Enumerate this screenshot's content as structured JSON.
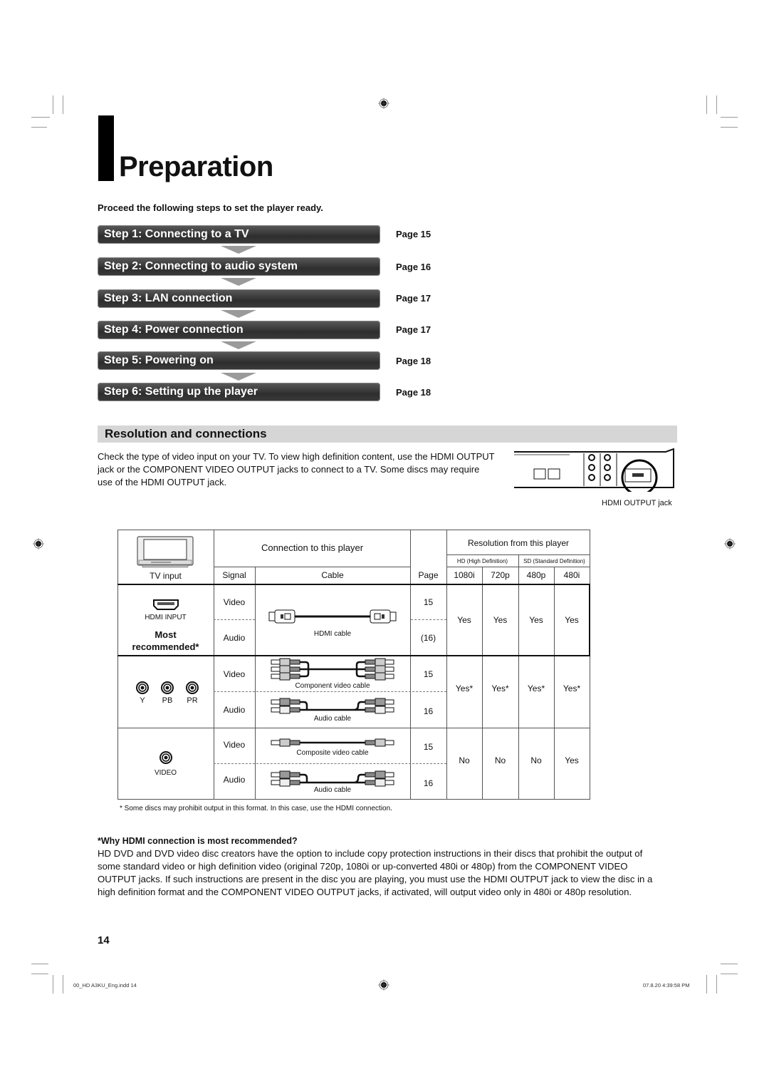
{
  "page": {
    "title": "Preparation",
    "intro": "Proceed the following steps to set the player ready.",
    "page_number": "14"
  },
  "steps": [
    {
      "label": "Step 1: Connecting to a TV",
      "page": "Page 15"
    },
    {
      "label": "Step 2: Connecting to audio system",
      "page": "Page 16"
    },
    {
      "label": "Step 3: LAN connection",
      "page": "Page 17"
    },
    {
      "label": "Step 4: Power connection",
      "page": "Page 17"
    },
    {
      "label": "Step 5: Powering on",
      "page": "Page 18"
    },
    {
      "label": "Step 6: Setting up the player",
      "page": "Page 18"
    }
  ],
  "section": {
    "title": "Resolution and connections",
    "description": "Check the type of video input on your TV. To view high definition content, use the HDMI OUTPUT jack or the COMPONENT VIDEO OUTPUT jacks to connect to a TV. Some discs may require use of the HDMI OUTPUT jack.",
    "diagram_caption": "HDMI OUTPUT jack"
  },
  "table": {
    "header": {
      "tv_input": "TV input",
      "connection": "Connection to this player",
      "resolution": "Resolution from this player",
      "hd": "HD (High Definition)",
      "sd": "SD (Standard Definition)",
      "signal": "Signal",
      "cable": "Cable",
      "page": "Page",
      "res_cols": [
        "1080i",
        "720p",
        "480p",
        "480i"
      ]
    },
    "rows": [
      {
        "input_label": "HDMI INPUT",
        "note": "Most recommended*",
        "signals": [
          "Video",
          "Audio"
        ],
        "cable_labels": [
          "HDMI cable"
        ],
        "pages": [
          "15",
          "(16)"
        ],
        "resolutions": [
          "Yes",
          "Yes",
          "Yes",
          "Yes"
        ]
      },
      {
        "input_labels": [
          "Y",
          "PB",
          "PR"
        ],
        "signals": [
          "Video",
          "Audio"
        ],
        "cable_labels": [
          "Component video cable",
          "Audio cable"
        ],
        "pages": [
          "15",
          "16"
        ],
        "resolutions": [
          "Yes*",
          "Yes*",
          "Yes*",
          "Yes*"
        ]
      },
      {
        "input_label": "VIDEO",
        "signals": [
          "Video",
          "Audio"
        ],
        "cable_labels": [
          "Composite video cable",
          "Audio cable"
        ],
        "pages": [
          "15",
          "16"
        ],
        "resolutions": [
          "No",
          "No",
          "No",
          "Yes"
        ]
      }
    ],
    "footnote": "* Some discs may prohibit output in this format. In this case, use the HDMI connection."
  },
  "why": {
    "title": "*Why HDMI connection is most recommended?",
    "body": "HD DVD and DVD video disc creators have the option to include copy protection instructions in their discs that prohibit the output of some standard video or high definition video (original 720p, 1080i or up-converted 480i or 480p) from the COMPONENT VIDEO OUTPUT jacks. If such instructions are present in the disc you are playing, you must use the HDMI OUTPUT jack to view the disc in a high definition format and the COMPONENT VIDEO OUTPUT jacks, if activated, will output video only in 480i or 480p resolution."
  },
  "slug": {
    "file": "00_HD A3KU_Eng.indd   14",
    "date": "07.8.20   4:39:58 PM"
  }
}
